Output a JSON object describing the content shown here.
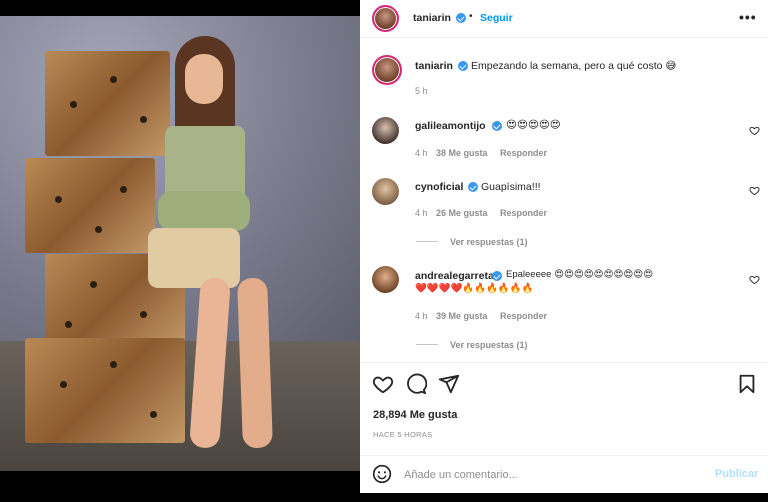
{
  "header": {
    "username": "taniarin",
    "separator": "•",
    "follow_label": "Seguir",
    "more_label": "•••"
  },
  "caption": {
    "username": "taniarin",
    "text": "Empezando la semana, pero a qué costo 😅",
    "time": "5 h"
  },
  "comments": [
    {
      "username": "galileamontijo",
      "text": "😍😍😍😍😍",
      "time": "4 h",
      "likes": "38 Me gusta",
      "reply_label": "Responder"
    },
    {
      "username": "cynoficial",
      "text": "Guapísima!!!",
      "time": "4 h",
      "likes": "26 Me gusta",
      "reply_label": "Responder",
      "view_replies": "Ver respuestas (1)"
    },
    {
      "username": "andrealegarreta",
      "text": "Epaleeeee 😍😍😍😍😍😍😍😍😍😍",
      "text2": "❤️❤️❤️❤️🔥🔥🔥🔥🔥🔥",
      "time": "4 h",
      "likes": "39 Me gusta",
      "reply_label": "Responder",
      "view_replies": "Ver respuestas (1)"
    }
  ],
  "actions": {
    "likes_count": "28,894 Me gusta",
    "posted_ago": "HACE 5 HORAS"
  },
  "comment_box": {
    "placeholder": "Añade un comentario...",
    "publish_label": "Publicar"
  },
  "colors": {
    "link_blue": "#0095f6",
    "verified_blue": "#3897f0",
    "publish_disabled": "#b2dffc",
    "muted": "#8e8e8e"
  },
  "icons": [
    "heart-icon",
    "comment-icon",
    "share-icon",
    "bookmark-icon",
    "emoji-icon",
    "verified-icon",
    "more-options-icon"
  ]
}
